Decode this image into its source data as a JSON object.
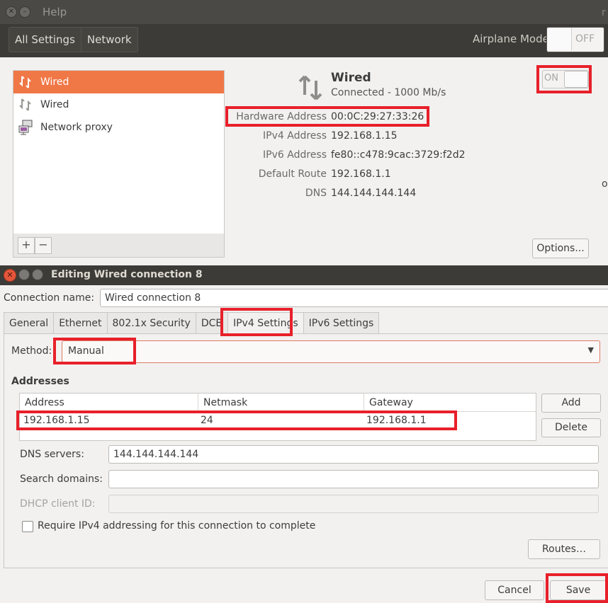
{
  "settings_window": {
    "title": "Help",
    "breadcrumbs": [
      "All Settings",
      "Network"
    ],
    "airplane_mode": {
      "label": "Airplane Mode",
      "state": "OFF"
    },
    "connections": [
      {
        "label": "Wired",
        "icon": "network-wired-icon",
        "selected": true
      },
      {
        "label": "Wired",
        "icon": "network-wired-icon",
        "selected": false
      },
      {
        "label": "Network proxy",
        "icon": "network-proxy-icon",
        "selected": false
      }
    ],
    "list_buttons": {
      "add": "+",
      "remove": "−"
    },
    "detail": {
      "title": "Wired",
      "status": "Connected - 1000 Mb/s",
      "switch_state": "ON",
      "rows": [
        {
          "key": "Hardware Address",
          "value": "00:0C:29:27:33:26"
        },
        {
          "key": "IPv4 Address",
          "value": "192.168.1.15"
        },
        {
          "key": "IPv6 Address",
          "value": "fe80::c478:9cac:3729:f2d2"
        },
        {
          "key": "Default Route",
          "value": "192.168.1.1"
        },
        {
          "key": "DNS",
          "value": "144.144.144.144"
        }
      ],
      "options_button": "Options...",
      "edge_text": "ou",
      "edge_text_top": "r"
    }
  },
  "editor_dialog": {
    "title": "Editing Wired connection 8",
    "connection_name_label": "Connection name:",
    "connection_name_value": "Wired connection 8",
    "tabs": [
      "General",
      "Ethernet",
      "802.1x Security",
      "DCB",
      "IPv4 Settings",
      "IPv6 Settings"
    ],
    "active_tab": "IPv4 Settings",
    "method_label": "Method:",
    "method_value": "Manual",
    "addresses_heading": "Addresses",
    "address_table": {
      "columns": [
        "Address",
        "Netmask",
        "Gateway"
      ],
      "rows": [
        [
          "192.168.1.15",
          "24",
          "192.168.1.1"
        ]
      ]
    },
    "add_button": "Add",
    "delete_button": "Delete",
    "dns_label": "DNS servers:",
    "dns_value": "144.144.144.144",
    "search_label": "Search domains:",
    "search_value": "",
    "dhcp_label": "DHCP client ID:",
    "dhcp_value": "",
    "require_label": "Require IPv4 addressing for this connection to complete",
    "require_checked": false,
    "routes_button": "Routes…",
    "cancel_button": "Cancel",
    "save_button": "Save"
  },
  "colors": {
    "selection_accent": "#f07746",
    "annotation_red": "#e8202a",
    "titlebar_dark": "#3c3b37",
    "close_button": "#e4563b"
  }
}
